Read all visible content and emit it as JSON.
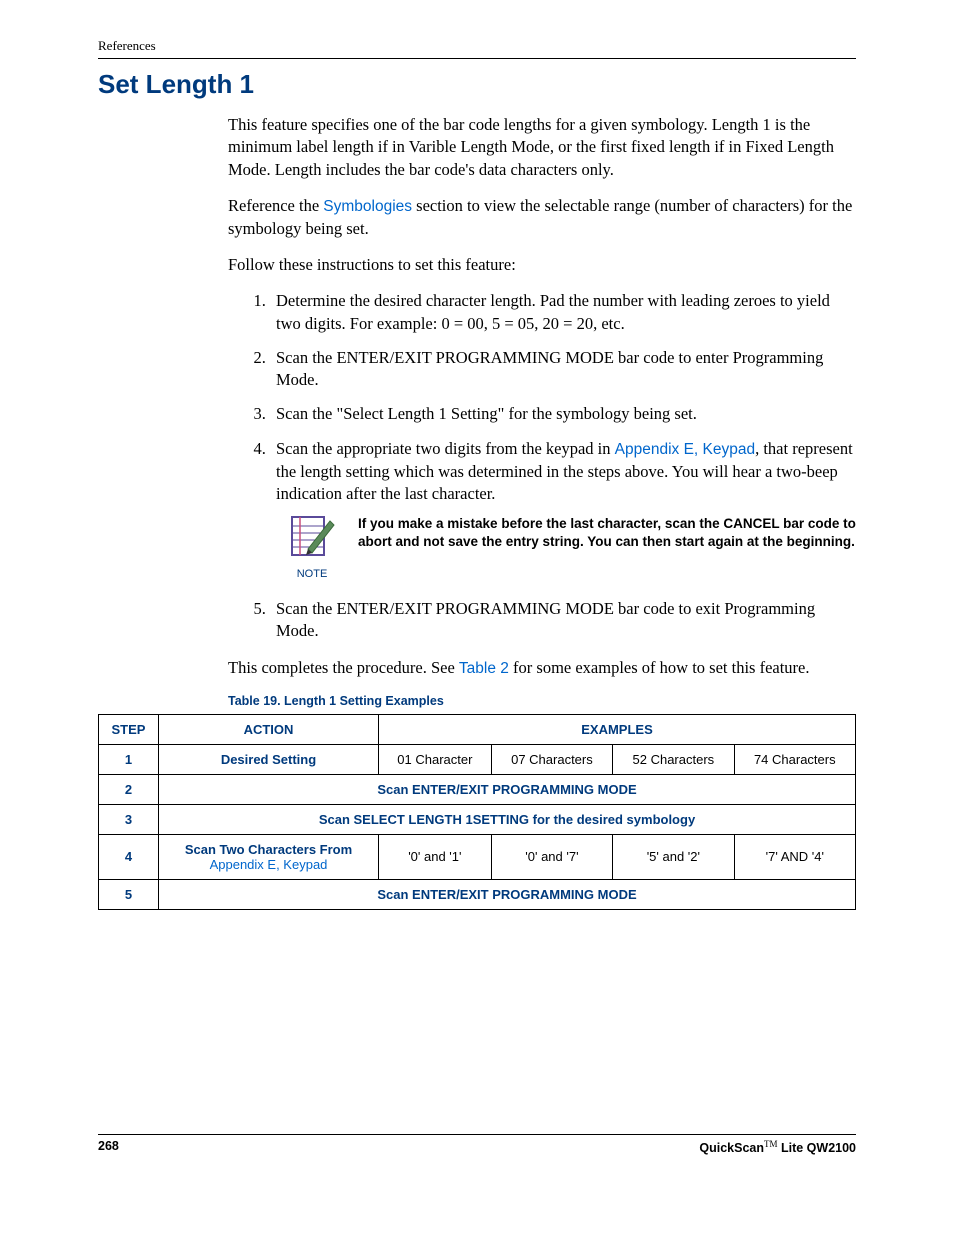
{
  "header": {
    "ref": "References"
  },
  "title": "Set Length 1",
  "paras": {
    "intro": "This feature specifies one of the bar code lengths for a given symbology. Length 1 is the minimum label length if in Varible Length Mode, or the first fixed length if in Fixed Length Mode. Length includes the bar code's data characters only.",
    "ref_pre": "Reference the ",
    "ref_link": "Symbologies",
    "ref_post": " section to view the selectable range (number of characters) for the symbology being set.",
    "follow": "Follow these instructions to set this feature:",
    "complete_pre": "This completes the procedure. See ",
    "complete_link": "Table 2",
    "complete_post": " for some examples of how to set this feature."
  },
  "steps": {
    "s1": "Determine the desired character length. Pad the number with leading zeroes to yield two digits. For example: 0 = 00, 5 = 05, 20 = 20, etc.",
    "s2": "Scan the ENTER/EXIT PROGRAMMING MODE bar code to enter Programming Mode.",
    "s3": "Scan the \"Select Length 1 Setting\" for the symbology being set.",
    "s4_pre": "Scan the appropriate two digits from the keypad in ",
    "s4_link": "Appendix E, Keypad",
    "s4_post": ", that represent the length setting which was determined in the steps above. You will hear a two-beep indication after the last character.",
    "s5": "Scan the ENTER/EXIT PROGRAMMING MODE bar code to exit Programming Mode."
  },
  "note": {
    "label": "NOTE",
    "text": "If you make a mistake before the last character, scan the CANCEL bar code to abort and not save the entry string. You can then start again at the beginning."
  },
  "table": {
    "caption": "Table 19. Length 1 Setting Examples",
    "headers": {
      "step": "STEP",
      "action": "ACTION",
      "examples": "EXAMPLES"
    },
    "row1": {
      "step": "1",
      "action": "Desired Setting",
      "ex1": "01 Character",
      "ex2": "07 Characters",
      "ex3": "52 Characters",
      "ex4": "74 Characters"
    },
    "row2": {
      "step": "2",
      "span": "Scan ENTER/EXIT PROGRAMMING MODE"
    },
    "row3": {
      "step": "3",
      "span": "Scan SELECT LENGTH 1SETTING for the desired symbology"
    },
    "row4": {
      "step": "4",
      "action_line1": "Scan Two Characters From",
      "action_link": "Appendix E, Keypad",
      "ex1": "'0' and '1'",
      "ex2": "'0' and '7'",
      "ex3": "'5' and '2'",
      "ex4": "'7' AND '4'"
    },
    "row5": {
      "step": "5",
      "span": "Scan ENTER/EXIT PROGRAMMING MODE"
    }
  },
  "footer": {
    "page": "268",
    "product_pre": "QuickScan",
    "tm": "TM",
    "product_post": " Lite QW2100"
  }
}
